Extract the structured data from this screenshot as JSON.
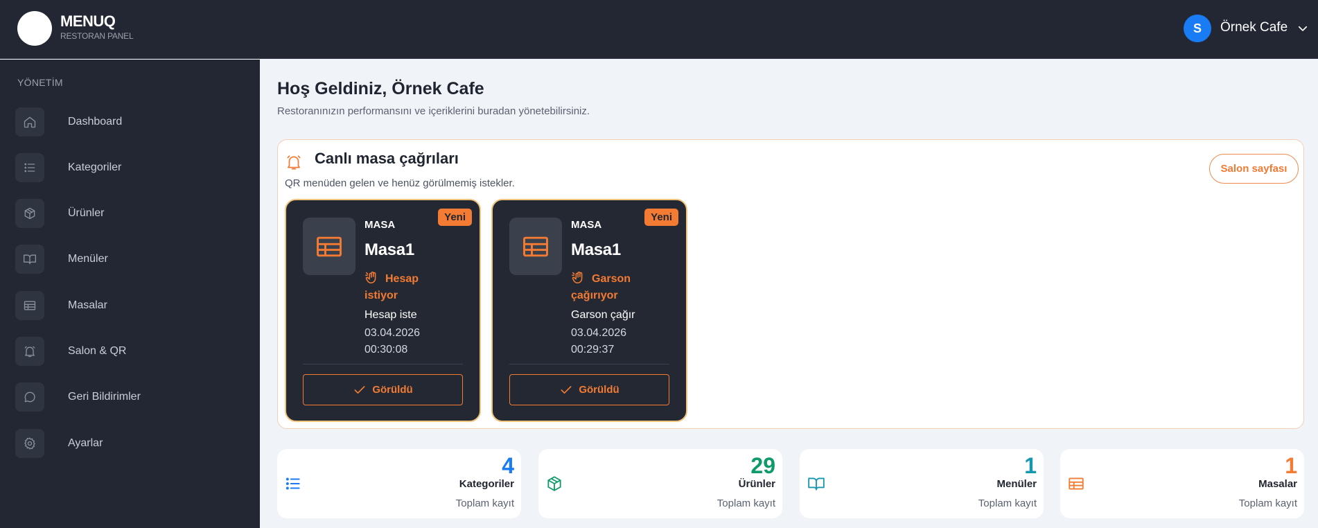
{
  "brand": {
    "name": "MENUQ",
    "subtitle": "RESTORAN PANEL"
  },
  "user": {
    "initial": "S",
    "name": "Örnek Cafe"
  },
  "sidebar": {
    "section": "YÖNETİM",
    "items": [
      {
        "label": "Dashboard",
        "icon": "home-icon"
      },
      {
        "label": "Kategoriler",
        "icon": "list-icon"
      },
      {
        "label": "Ürünler",
        "icon": "box-icon"
      },
      {
        "label": "Menüler",
        "icon": "book-icon"
      },
      {
        "label": "Masalar",
        "icon": "table-icon"
      },
      {
        "label": "Salon & QR",
        "icon": "bell-icon"
      },
      {
        "label": "Geri Bildirimler",
        "icon": "chat-icon"
      },
      {
        "label": "Ayarlar",
        "icon": "gear-icon"
      }
    ]
  },
  "main": {
    "title": "Hoş Geldiniz, Örnek Cafe",
    "subtitle": "Restoranınızın performansını ve içeriklerini buradan yönetebilirsiniz."
  },
  "calls": {
    "title": "Canlı masa çağrıları",
    "subtitle": "QR menüden gelen ve henüz görülmemiş istekler.",
    "salon_button": "Salon sayfası",
    "cards": [
      {
        "label": "MASA",
        "name": "Masa1",
        "badge": "Yeni",
        "status_line1": "Hesap",
        "status_line2": "istiyor",
        "request": "Hesap iste",
        "date": "03.04.2026",
        "time": "00:30:08",
        "button": "Görüldü"
      },
      {
        "label": "MASA",
        "name": "Masa1",
        "badge": "Yeni",
        "status_line1": "Garson",
        "status_line2": "çağırıyor",
        "request": "Garson çağır",
        "date": "03.04.2026",
        "time": "00:29:37",
        "button": "Görüldü"
      }
    ]
  },
  "stats": [
    {
      "value": "4",
      "label": "Kategoriler",
      "sub": "Toplam kayıt",
      "color": "#1a7cf5",
      "icon": "list-icon"
    },
    {
      "value": "29",
      "label": "Ürünler",
      "sub": "Toplam kayıt",
      "color": "#0f9a6a",
      "icon": "box-icon"
    },
    {
      "value": "1",
      "label": "Menüler",
      "sub": "Toplam kayıt",
      "color": "#1796b0",
      "icon": "book-icon"
    },
    {
      "value": "1",
      "label": "Masalar",
      "sub": "Toplam kayıt",
      "color": "#f37b33",
      "icon": "table-icon"
    }
  ],
  "colors": {
    "accent": "#f37b33",
    "sidebar_bg": "#222733",
    "card_bg": "#232833",
    "page_bg": "#f0f3f7"
  }
}
